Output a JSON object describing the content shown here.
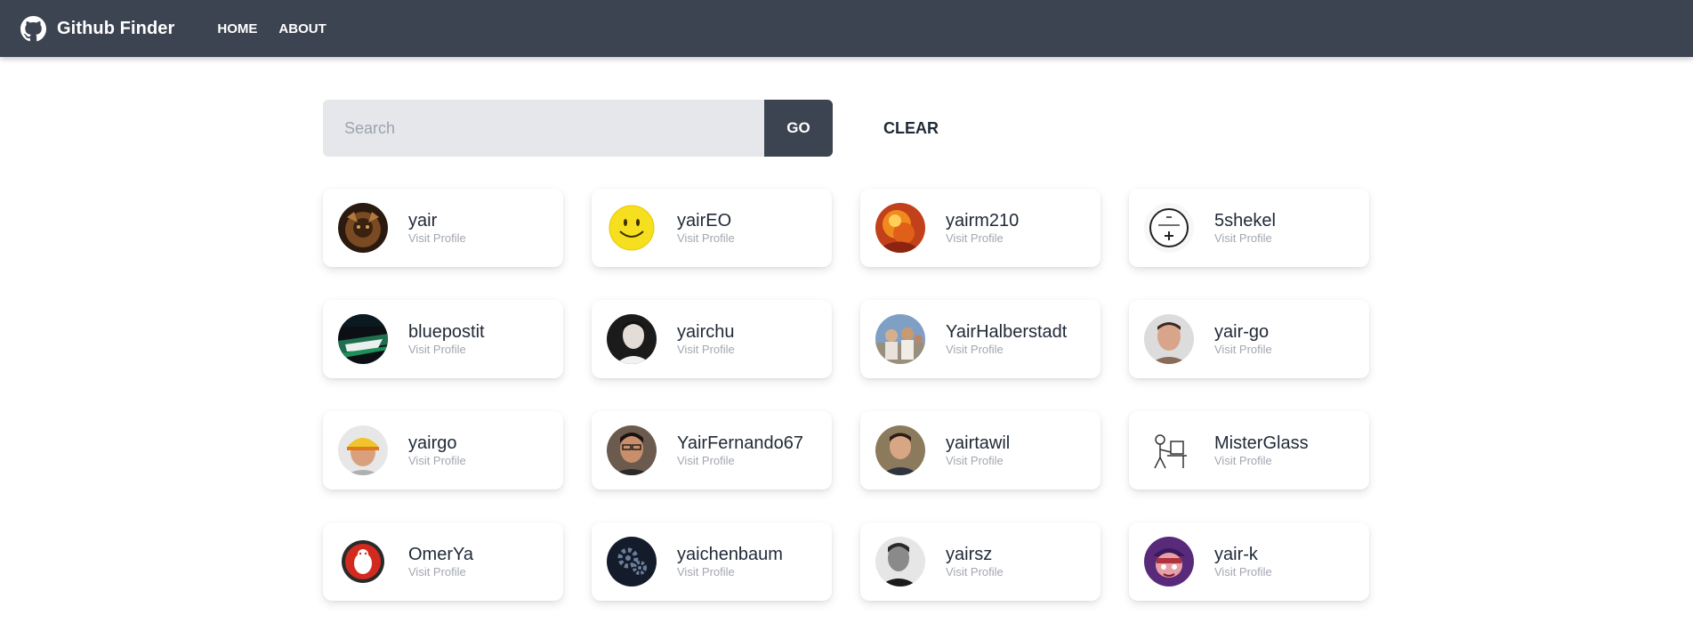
{
  "navbar": {
    "brand": "Github Finder",
    "links": [
      "HOME",
      "ABOUT"
    ]
  },
  "search": {
    "placeholder": "Search",
    "value": "",
    "go_label": "GO",
    "clear_label": "CLEAR"
  },
  "users": [
    {
      "login": "yair",
      "link_label": "Visit Profile",
      "avatar": "dark-creature-avatar"
    },
    {
      "login": "yairEO",
      "link_label": "Visit Profile",
      "avatar": "smiley-face-avatar"
    },
    {
      "login": "yairm210",
      "link_label": "Visit Profile",
      "avatar": "fire-avatar"
    },
    {
      "login": "5shekel",
      "link_label": "Visit Profile",
      "avatar": "sketch-avatar"
    },
    {
      "login": "bluepostit",
      "link_label": "Visit Profile",
      "avatar": "dark-abstract-avatar"
    },
    {
      "login": "yairchu",
      "link_label": "Visit Profile",
      "avatar": "portrait-avatar"
    },
    {
      "login": "YairHalberstadt",
      "link_label": "Visit Profile",
      "avatar": "group-photo-avatar"
    },
    {
      "login": "yair-go",
      "link_label": "Visit Profile",
      "avatar": "portrait-avatar"
    },
    {
      "login": "yairgo",
      "link_label": "Visit Profile",
      "avatar": "cap-portrait-avatar"
    },
    {
      "login": "YairFernando67",
      "link_label": "Visit Profile",
      "avatar": "portrait-avatar"
    },
    {
      "login": "yairtawil",
      "link_label": "Visit Profile",
      "avatar": "portrait-avatar"
    },
    {
      "login": "MisterGlass",
      "link_label": "Visit Profile",
      "avatar": "desk-sketch-avatar"
    },
    {
      "login": "OmerYa",
      "link_label": "Visit Profile",
      "avatar": "red-logo-avatar"
    },
    {
      "login": "yaichenbaum",
      "link_label": "Visit Profile",
      "avatar": "gears-avatar"
    },
    {
      "login": "yairsz",
      "link_label": "Visit Profile",
      "avatar": "bw-portrait-avatar"
    },
    {
      "login": "yair-k",
      "link_label": "Visit Profile",
      "avatar": "cartoon-avatar"
    }
  ],
  "colors": {
    "navbar_bg": "#3d4451",
    "search_bg": "#e5e7eb",
    "button_bg": "#3d4451",
    "muted_text": "#a3a7b0"
  }
}
